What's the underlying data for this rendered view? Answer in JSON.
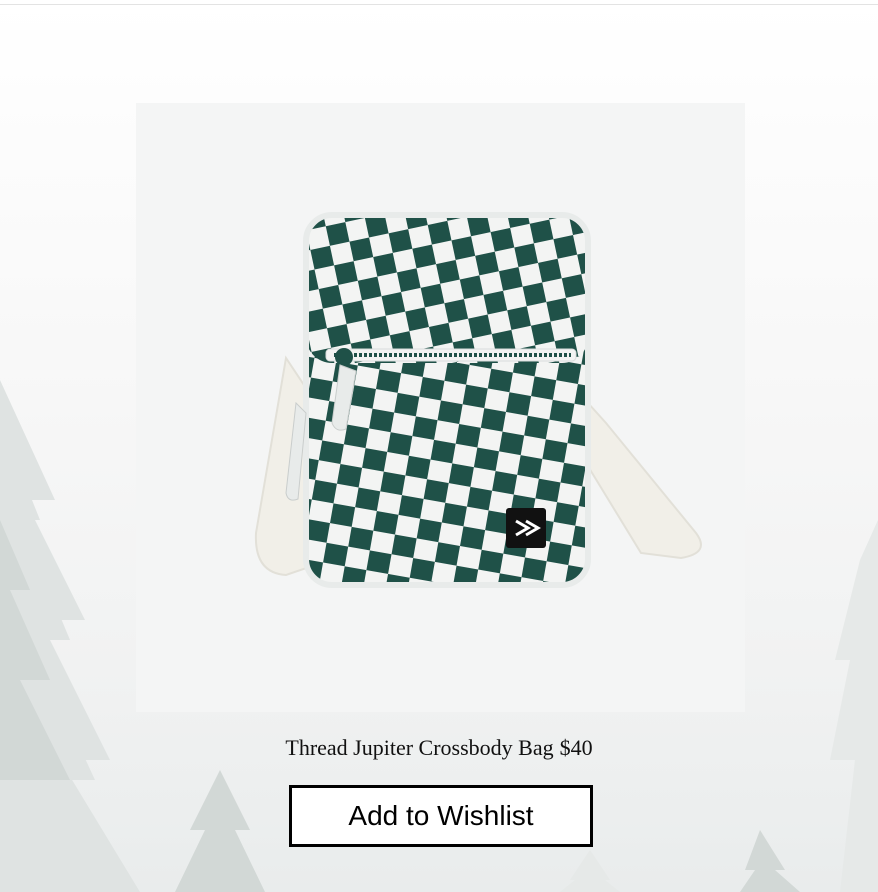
{
  "product": {
    "name": "Thread Jupiter Crossbody Bag",
    "price": "$40",
    "image_icon": "checkered-crossbody-bag-photo"
  },
  "actions": {
    "wishlist_label": "Add to Wishlist"
  },
  "colors": {
    "checker_dark": "#1f5148",
    "checker_light": "#f3f4f3",
    "strap": "#f1efe8",
    "background_tree": "#d4dad8"
  }
}
